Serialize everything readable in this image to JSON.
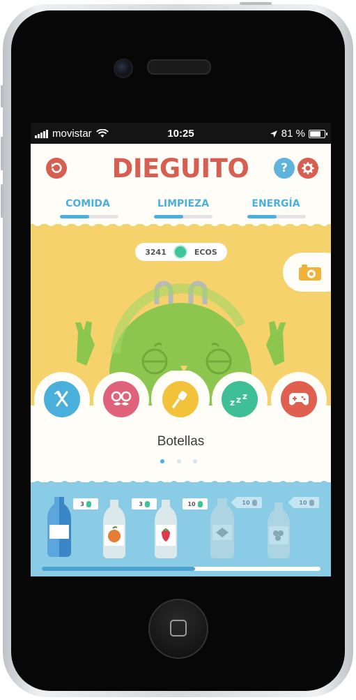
{
  "status_bar": {
    "carrier": "movistar",
    "time": "10:25",
    "battery": "81 %",
    "battery_level": 0.81
  },
  "header": {
    "title": "DIEGUITO",
    "back_icon": "back-arrow-icon",
    "help_label": "?",
    "settings_icon": "gear-icon"
  },
  "tabs": [
    {
      "label": "COMIDA",
      "progress": 0.5
    },
    {
      "label": "LIMPIEZA",
      "progress": 0.5
    },
    {
      "label": "ENERGÍA",
      "progress": 0.5
    }
  ],
  "currency": {
    "amount": "3241",
    "label": "ECOS"
  },
  "actions": [
    {
      "name": "food",
      "icon": "fork-knife-icon",
      "color": "#4ab0db"
    },
    {
      "name": "disguise",
      "icon": "glasses-mustache-icon",
      "color": "#e0617a"
    },
    {
      "name": "cleaning",
      "icon": "brush-icon",
      "color": "#f2c23a"
    },
    {
      "name": "sleep",
      "icon": "zzz-icon",
      "color": "#3fbf95"
    },
    {
      "name": "games",
      "icon": "gamepad-icon",
      "color": "#e0604f"
    }
  ],
  "selected_item": "Botellas",
  "pagination": {
    "pages": 3,
    "current": 1
  },
  "items": [
    {
      "price": "3",
      "locked": false,
      "label_icon": "blank-label-icon"
    },
    {
      "price": "3",
      "locked": false,
      "label_icon": "orange-fruit-icon"
    },
    {
      "price": "10",
      "locked": false,
      "label_icon": "strawberry-icon"
    },
    {
      "price": "10",
      "locked": true,
      "label_icon": "diamond-label-icon"
    },
    {
      "price": "10",
      "locked": true,
      "label_icon": "grapes-icon"
    }
  ],
  "scroll_position": 0.55,
  "colors": {
    "title": "#d75f52",
    "tab_accent": "#4ab0db",
    "sky": "#f6d26c",
    "water": "#8acbe5",
    "character": "#8cc64e",
    "coin": "#3ec39a"
  }
}
